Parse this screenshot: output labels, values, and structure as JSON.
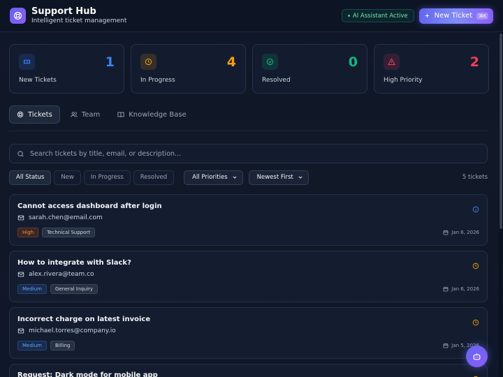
{
  "header": {
    "title": "Support Hub",
    "subtitle": "Intelligent ticket management",
    "ai_badge": "AI Assistant Active",
    "new_ticket_label": "New Ticket",
    "shortcut": "⌘K"
  },
  "stats": [
    {
      "label": "New Tickets",
      "value": "1",
      "color": "#3b82f6",
      "icon": "ticket-icon"
    },
    {
      "label": "In Progress",
      "value": "4",
      "color": "#f59e0b",
      "icon": "clock-icon"
    },
    {
      "label": "Resolved",
      "value": "0",
      "color": "#10b981",
      "icon": "check-circle-icon"
    },
    {
      "label": "High Priority",
      "value": "2",
      "color": "#f43f5e",
      "icon": "alert-triangle-icon"
    }
  ],
  "tabs": [
    {
      "label": "Tickets",
      "icon": "lifebuoy-icon",
      "active": true
    },
    {
      "label": "Team",
      "icon": "users-icon"
    },
    {
      "label": "Knowledge Base",
      "icon": "book-icon"
    }
  ],
  "search": {
    "placeholder": "Search tickets by title, email, or description..."
  },
  "filters": {
    "status": [
      "All Status",
      "New",
      "In Progress",
      "Resolved"
    ],
    "priority_selected": "All Priorities",
    "sort_selected": "Newest First",
    "count": "5 tickets"
  },
  "tickets": [
    {
      "title": "Cannot access dashboard after login",
      "email": "sarah.chen@email.com",
      "priority": "High",
      "category": "Technical Support",
      "date": "Jan 6, 2026",
      "status_icon": "info-circle-icon"
    },
    {
      "title": "How to integrate with Slack?",
      "email": "alex.rivera@team.co",
      "priority": "Medium",
      "category": "General Inquiry",
      "date": "Jan 6, 2026",
      "status_icon": "clock-icon"
    },
    {
      "title": "Incorrect charge on latest invoice",
      "email": "michael.torres@company.io",
      "priority": "Medium",
      "category": "Billing",
      "date": "Jan 5, 2026",
      "status_icon": "clock-icon"
    },
    {
      "title": "Request: Dark mode for mobile app",
      "status_icon": "clock-icon"
    }
  ],
  "colors": {
    "accent": "#6366f1",
    "high": "#fb923c",
    "medium": "#60a5fa",
    "in_progress": "#f59e0b",
    "new": "#3b82f6"
  }
}
